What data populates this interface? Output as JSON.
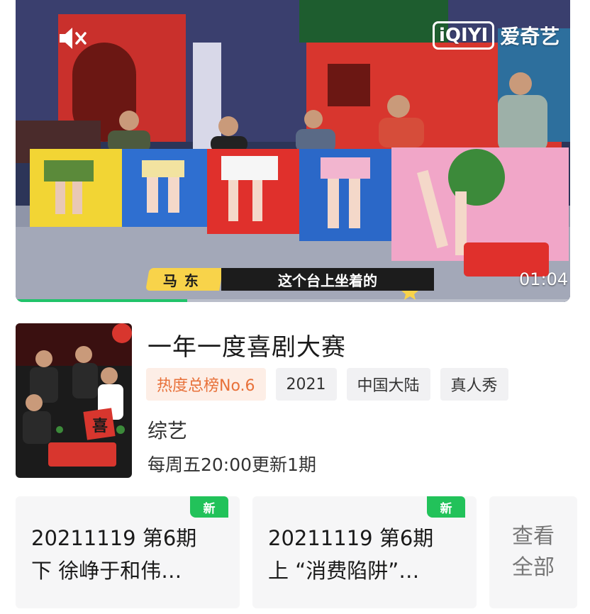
{
  "player": {
    "watermark_logo": "iQIYI",
    "watermark_text": "爱奇艺",
    "subtitle_speaker": "马东",
    "subtitle_text": "这个台上坐着的",
    "time": "01:04",
    "progress": 0.31,
    "icons": {
      "mute": "speaker-muted-icon"
    },
    "colors": {
      "progress": "#21c36a",
      "name_bg": "#f8d34a"
    }
  },
  "show": {
    "title": "一年一度喜剧大赛",
    "tags": [
      "热度总榜No.6",
      "2021",
      "中国大陆",
      "真人秀"
    ],
    "genre": "综艺",
    "schedule": "每周五20:00更新1期"
  },
  "episodes": [
    {
      "badge": "新",
      "line1": "20211119 第6期",
      "line2": "下 徐峥于和伟…"
    },
    {
      "badge": "新",
      "line1": "20211119 第6期",
      "line2": "上 “消费陷阱”…"
    }
  ],
  "view_all": "查看\n全部"
}
